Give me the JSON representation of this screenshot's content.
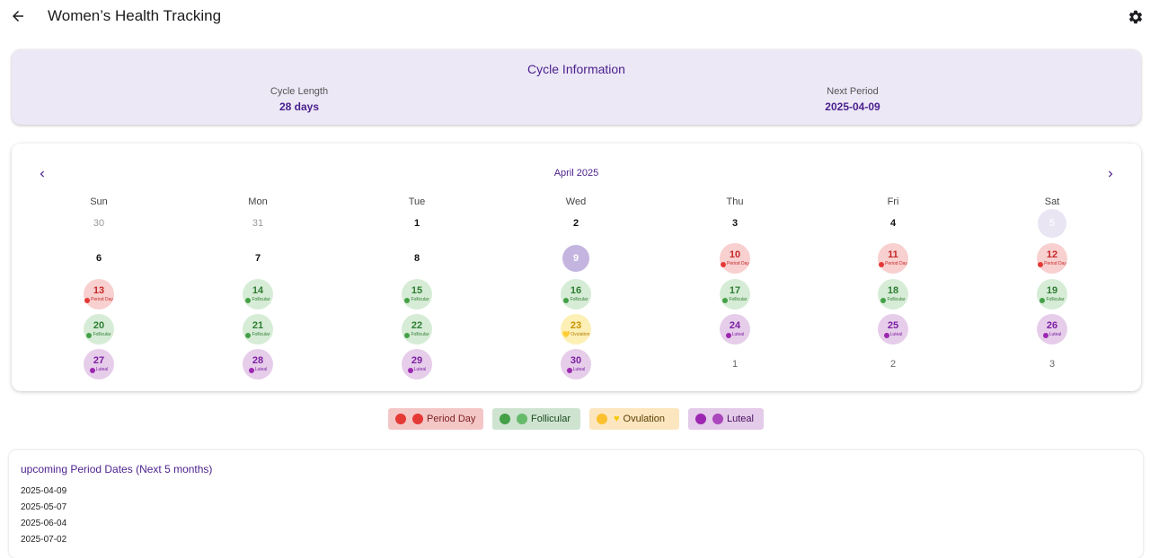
{
  "header": {
    "title": "Women’s Health Tracking",
    "back_icon": "arrow-back-icon",
    "settings_icon": "gear-icon"
  },
  "cycle_info": {
    "title": "Cycle Information",
    "cycle_length_label": "Cycle Length",
    "cycle_length_value": "28 days",
    "next_period_label": "Next Period",
    "next_period_value": "2025-04-09"
  },
  "calendar": {
    "month_label": "April 2025",
    "weekdays": [
      "Sun",
      "Mon",
      "Tue",
      "Wed",
      "Thu",
      "Fri",
      "Sat"
    ],
    "weeks": [
      [
        {
          "num": "30",
          "state": "other"
        },
        {
          "num": "31",
          "state": "other"
        },
        {
          "num": "1",
          "state": "plain"
        },
        {
          "num": "2",
          "state": "plain"
        },
        {
          "num": "3",
          "state": "plain"
        },
        {
          "num": "4",
          "state": "plain"
        },
        {
          "num": "5",
          "state": "today"
        }
      ],
      [
        {
          "num": "6",
          "state": "plain"
        },
        {
          "num": "7",
          "state": "plain"
        },
        {
          "num": "8",
          "state": "plain"
        },
        {
          "num": "9",
          "state": "selected"
        },
        {
          "num": "10",
          "state": "period",
          "tag": "Period Day"
        },
        {
          "num": "11",
          "state": "period",
          "tag": "Period Day"
        },
        {
          "num": "12",
          "state": "period",
          "tag": "Period Day"
        }
      ],
      [
        {
          "num": "13",
          "state": "period",
          "tag": "Period Day"
        },
        {
          "num": "14",
          "state": "follicular",
          "tag": "Follicular"
        },
        {
          "num": "15",
          "state": "follicular",
          "tag": "Follicular"
        },
        {
          "num": "16",
          "state": "follicular",
          "tag": "Follicular"
        },
        {
          "num": "17",
          "state": "follicular",
          "tag": "Follicular"
        },
        {
          "num": "18",
          "state": "follicular",
          "tag": "Follicular"
        },
        {
          "num": "19",
          "state": "follicular",
          "tag": "Follicular"
        }
      ],
      [
        {
          "num": "20",
          "state": "follicular",
          "tag": "Follicular"
        },
        {
          "num": "21",
          "state": "follicular",
          "tag": "Follicular"
        },
        {
          "num": "22",
          "state": "follicular",
          "tag": "Follicular"
        },
        {
          "num": "23",
          "state": "ovulation",
          "tag": "Ovulation"
        },
        {
          "num": "24",
          "state": "luteal",
          "tag": "Luteal"
        },
        {
          "num": "25",
          "state": "luteal",
          "tag": "Luteal"
        },
        {
          "num": "26",
          "state": "luteal",
          "tag": "Luteal"
        }
      ],
      [
        {
          "num": "27",
          "state": "luteal",
          "tag": "Luteal"
        },
        {
          "num": "28",
          "state": "luteal",
          "tag": "Luteal"
        },
        {
          "num": "29",
          "state": "luteal",
          "tag": "Luteal"
        },
        {
          "num": "30",
          "state": "luteal",
          "tag": "Luteal"
        },
        {
          "num": "1",
          "state": "other-plain"
        },
        {
          "num": "2",
          "state": "other-plain"
        },
        {
          "num": "3",
          "state": "other-plain"
        }
      ]
    ]
  },
  "legend": {
    "period_label": "Period Day",
    "follicular_label": "Follicular",
    "ovulation_label": "Ovulation",
    "luteal_label": "Luteal",
    "colors": {
      "period": "#e53935",
      "follicular": "#43a047",
      "ovulation": "#fbc02d",
      "luteal": "#9c27b0"
    }
  },
  "upcoming": {
    "title": "upcoming Period Dates (Next 5 months)",
    "dates": [
      "2025-04-09",
      "2025-05-07",
      "2025-06-04",
      "2025-07-02"
    ]
  },
  "colors": {
    "accent": "#4a1f8c",
    "card_background": "#ece8f6"
  }
}
